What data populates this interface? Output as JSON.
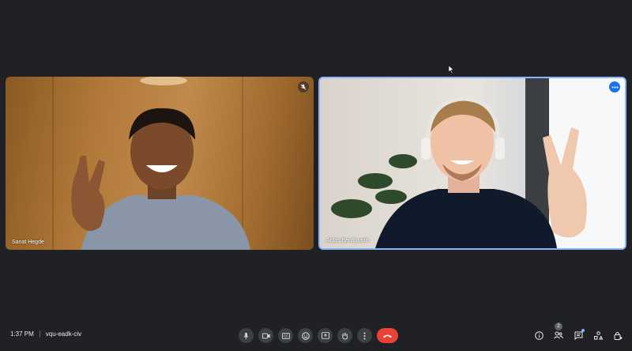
{
  "participants": [
    {
      "name": "Sanat Hegde",
      "muted": true
    },
    {
      "name": "Aidas Bendoraitis",
      "muted": false
    }
  ],
  "meeting": {
    "time": "1:37 PM",
    "code": "vqu-eadk-civ"
  },
  "toolbar": {
    "buttons": [
      "microphone-icon",
      "camera-icon",
      "captions-icon",
      "emoji-icon",
      "present-icon",
      "raise-hand-icon",
      "more-options-icon",
      "end-call-icon"
    ]
  },
  "side_controls": {
    "people_count": "2"
  },
  "colors": {
    "background": "#202124",
    "active_border": "#8ab4f8",
    "end_call": "#ea4335"
  }
}
